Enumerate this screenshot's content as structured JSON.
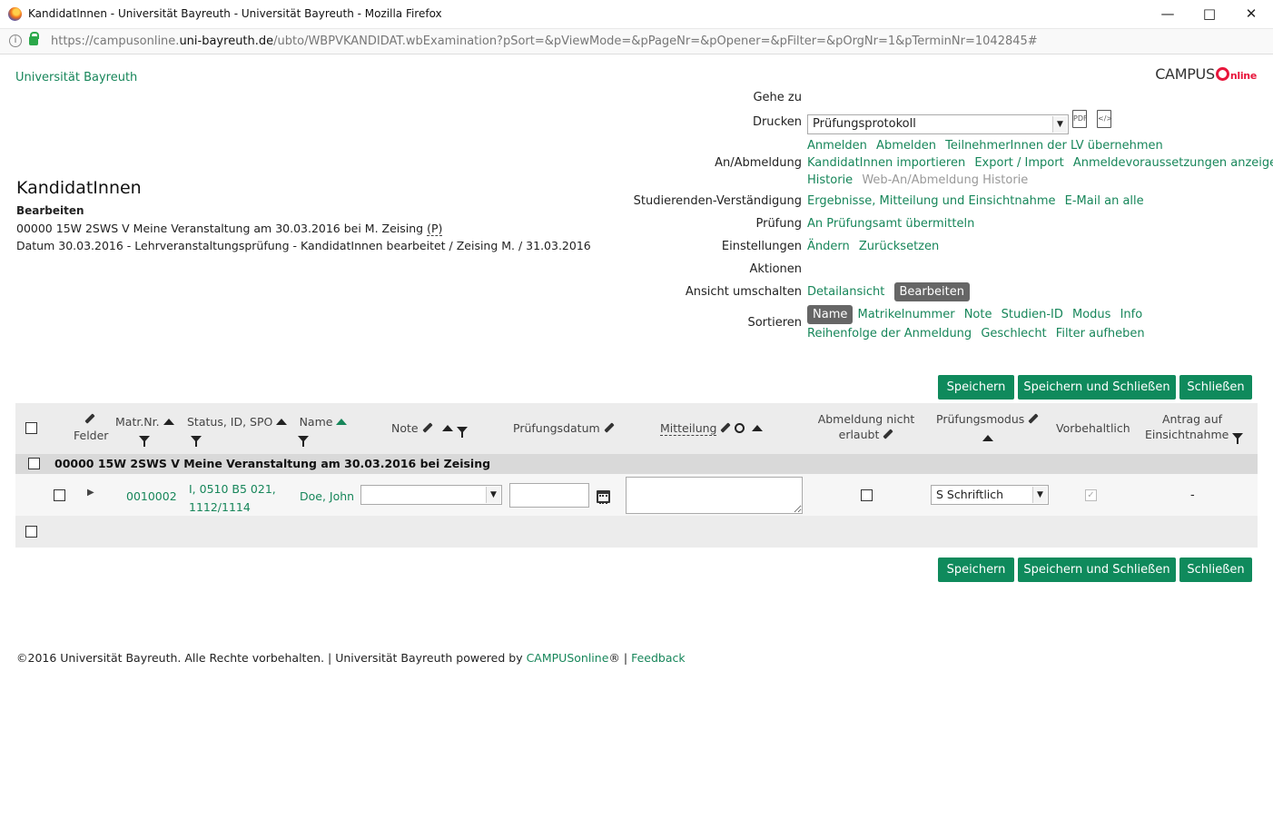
{
  "window": {
    "title": "KandidatInnen - Universität Bayreuth - Universität Bayreuth - Mozilla Firefox",
    "url_prefix": "https://campusonline.",
    "url_domain": "uni-bayreuth.de",
    "url_rest": "/ubto/WBPVKANDIDAT.wbExamination?pSort=&pViewMode=&pPageNr=&pOpener=&pFilter=&pOrgNr=1&pTerminNr=1042845#"
  },
  "header": {
    "university": "Universität Bayreuth",
    "logo_part1": "CAMPUS",
    "logo_part2": "nline"
  },
  "page": {
    "title": "KandidatInnen",
    "subtitle": "Bearbeiten",
    "desc1_a": "00000 15W 2SWS V Meine Veranstaltung am 30.03.2016 bei M. Zeising ",
    "desc1_b": "(P)",
    "desc2": "Datum 30.03.2016 - Lehrveranstaltungsprüfung - KandidatInnen bearbeitet / Zeising M. / 31.03.2016"
  },
  "actions": {
    "goto_label": "Gehe zu",
    "print_label": "Drucken",
    "print_select_value": "Prüfungsprotokoll",
    "pdf_icon_text": "PDF",
    "xml_icon_text": "</>",
    "anab_label": "An/Abmeldung",
    "anab_links": [
      "Anmelden",
      "Abmelden",
      "TeilnehmerInnen der LV übernehmen"
    ],
    "anab_links2": [
      "KandidatInnen importieren",
      "Export / Import",
      "Anmeldevoraussetzungen anzeigen"
    ],
    "anab_hist": "Historie",
    "anab_hist_grey": "Web-An/Abmeldung Historie",
    "stud_label": "Studierenden-Verständigung",
    "stud_links": [
      "Ergebnisse, Mitteilung und Einsichtnahme",
      "E-Mail an alle"
    ],
    "pruef_label": "Prüfung",
    "pruef_link": "An Prüfungsamt übermitteln",
    "einst_label": "Einstellungen",
    "einst_links": [
      "Ändern",
      "Zurücksetzen"
    ],
    "aktionen_label": "Aktionen",
    "ansicht_label": "Ansicht umschalten",
    "ansicht_link": "Detailansicht",
    "ansicht_active": "Bearbeiten",
    "sort_label": "Sortieren",
    "sort_active": "Name",
    "sort_links": [
      "Matrikelnummer",
      "Note",
      "Studien-ID",
      "Modus",
      "Info"
    ],
    "sort_links2": [
      "Reihenfolge der Anmeldung",
      "Geschlecht",
      "Filter aufheben"
    ]
  },
  "buttons": {
    "save": "Speichern",
    "save_close": "Speichern und Schließen",
    "close": "Schließen"
  },
  "table": {
    "columns": {
      "felder": "Felder",
      "matr": "Matr.Nr.",
      "status": "Status, ID, SPO",
      "name": "Name",
      "note": "Note",
      "datum": "Prüfungsdatum",
      "mitteilung": "Mitteilung",
      "abmeldung_1": "Abmeldung nicht",
      "abmeldung_2": "erlaubt",
      "modus": "Prüfungsmodus",
      "vorbehalt": "Vorbehaltlich",
      "antrag_1": "Antrag auf",
      "antrag_2": "Einsichtnahme"
    },
    "group_title": "00000 15W 2SWS V Meine Veranstaltung am 30.03.2016 bei Zeising",
    "rows": [
      {
        "matr": "0010002",
        "status_1": "I, 0510 B5 021,",
        "status_2": "1112/1114",
        "name": "Doe, John",
        "note": "",
        "datum": "",
        "mitteilung": "",
        "modus": "S Schriftlich",
        "antrag": "-"
      }
    ]
  },
  "footer": {
    "text": "©2016 Universität Bayreuth. Alle Rechte vorbehalten. | Universität Bayreuth powered by ",
    "campus_link": "CAMPUSonline",
    "reg": "®",
    "sep": " | ",
    "feedback": "Feedback"
  },
  "colors": {
    "accent": "#17865a",
    "button": "#0f8a5c",
    "logo_red": "#e8163b"
  }
}
